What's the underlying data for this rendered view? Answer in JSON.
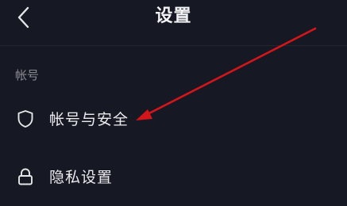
{
  "header": {
    "back_icon": "chevron-left-icon",
    "title": "设置"
  },
  "sections": [
    {
      "label": "帐号",
      "items": [
        {
          "icon": "shield-icon",
          "label": "帐号与安全"
        },
        {
          "icon": "lock-icon",
          "label": "隐私设置"
        }
      ]
    }
  ],
  "annotation": {
    "type": "arrow",
    "color": "#d4161b"
  },
  "colors": {
    "background": "#161823",
    "text": "#ececee",
    "section_label": "#8a8b91"
  }
}
